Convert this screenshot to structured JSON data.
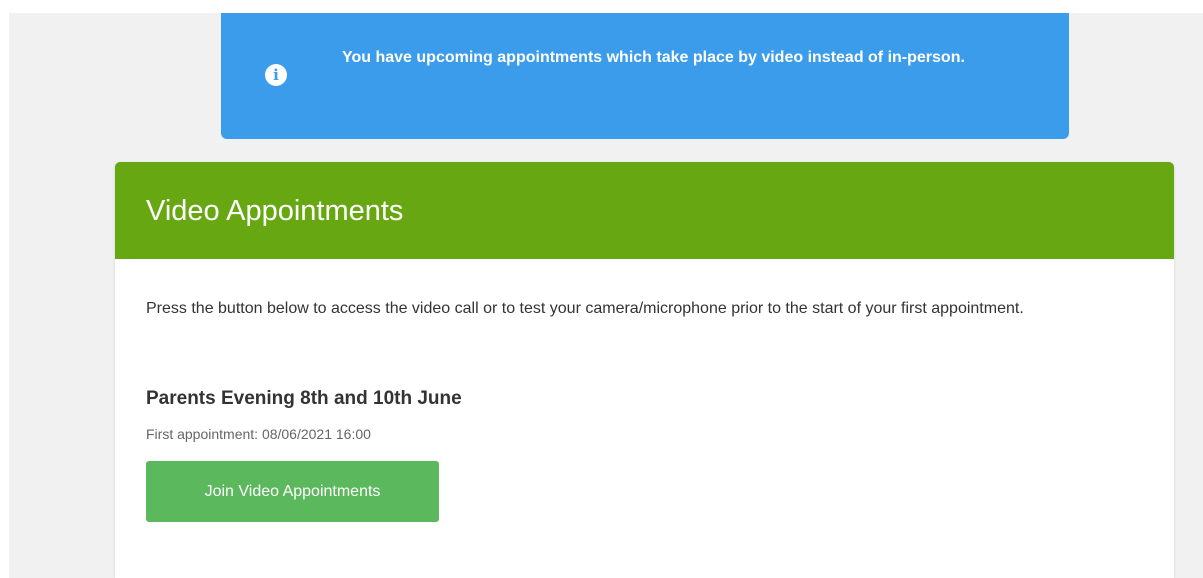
{
  "alert": {
    "icon": "info-icon",
    "icon_glyph": "i",
    "message": "You have upcoming appointments which take place by video instead of in-person.",
    "color": "#3c9cec"
  },
  "card": {
    "title": "Video Appointments",
    "header_color": "#67a812",
    "description": "Press the button below to access the video call or to test your camera/microphone prior to the start of your first appointment.",
    "event_name": "Parents Evening 8th and 10th June",
    "first_appointment": "First appointment: 08/06/2021 16:00",
    "join_button_label": "Join Video Appointments",
    "button_color": "#5cb85c"
  }
}
